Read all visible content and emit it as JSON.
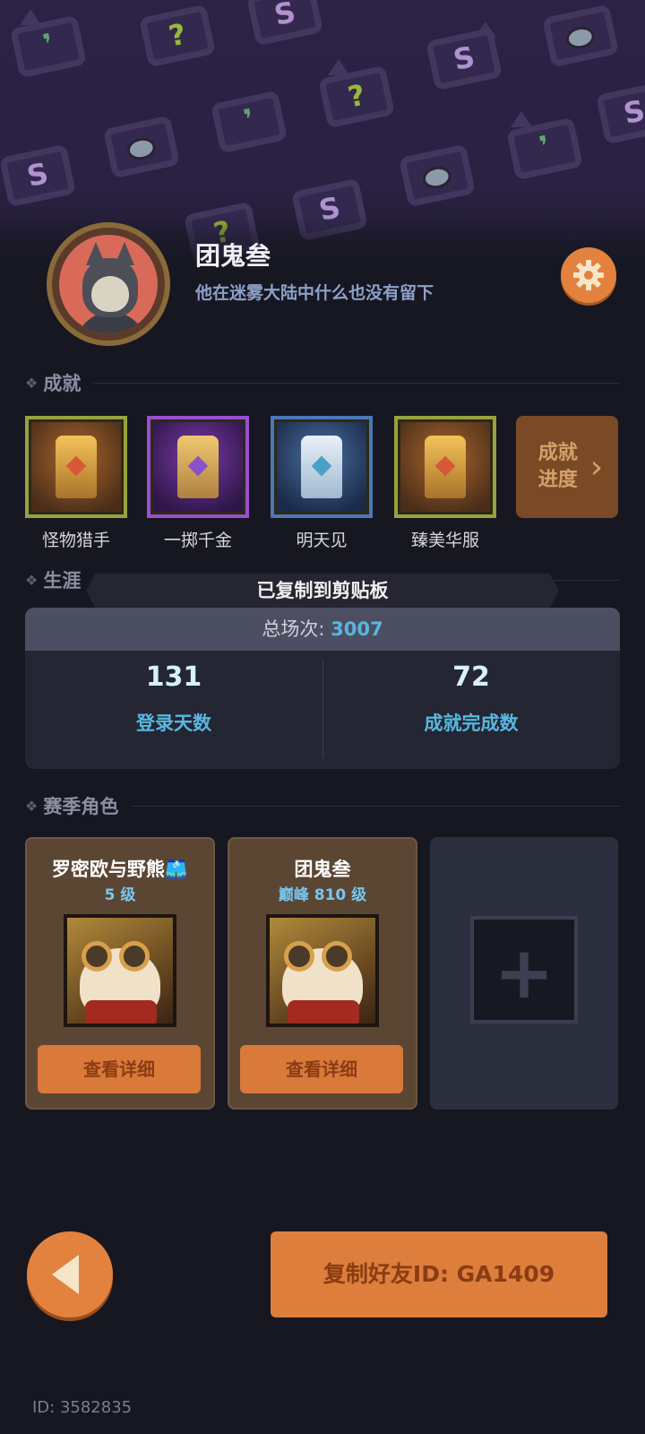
{
  "profile": {
    "name": "团鬼叁",
    "bio": "他在迷雾大陆中什么也没有留下"
  },
  "achievements": {
    "section_label": "成就",
    "items": [
      {
        "label": "怪物猎手",
        "rarity": "gold"
      },
      {
        "label": "一掷千金",
        "rarity": "purple"
      },
      {
        "label": "明天见",
        "rarity": "blue"
      },
      {
        "label": "臻美华服",
        "rarity": "gold"
      }
    ],
    "progress_label_line1": "成就",
    "progress_label_line2": "进度",
    "progress_chevron": "›"
  },
  "career": {
    "section_label": "生涯",
    "total_label": "总场次: ",
    "total_value": "3007",
    "stats": [
      {
        "value": "131",
        "label": "登录天数"
      },
      {
        "value": "72",
        "label": "成就完成数"
      }
    ]
  },
  "toast": {
    "message": "已复制到剪贴板"
  },
  "season_roles": {
    "section_label": "赛季角色",
    "roles": [
      {
        "name": "罗密欧与野熊🩳",
        "level": "5 级",
        "button": "查看详细"
      },
      {
        "name": "团鬼叁",
        "level": "巅峰 810 级",
        "button": "查看详细"
      }
    ],
    "empty_slot_symbol": "+"
  },
  "footer": {
    "copy_button": "复制好友ID: GA1409",
    "user_id": "ID: 3582835"
  },
  "icons": {
    "settings": "gear-icon",
    "back": "back-arrow-icon",
    "section_marker": "diamond-icon"
  },
  "colors": {
    "accent_orange": "#e3823e",
    "stat_blue": "#58b7e0",
    "background": "#161721"
  }
}
